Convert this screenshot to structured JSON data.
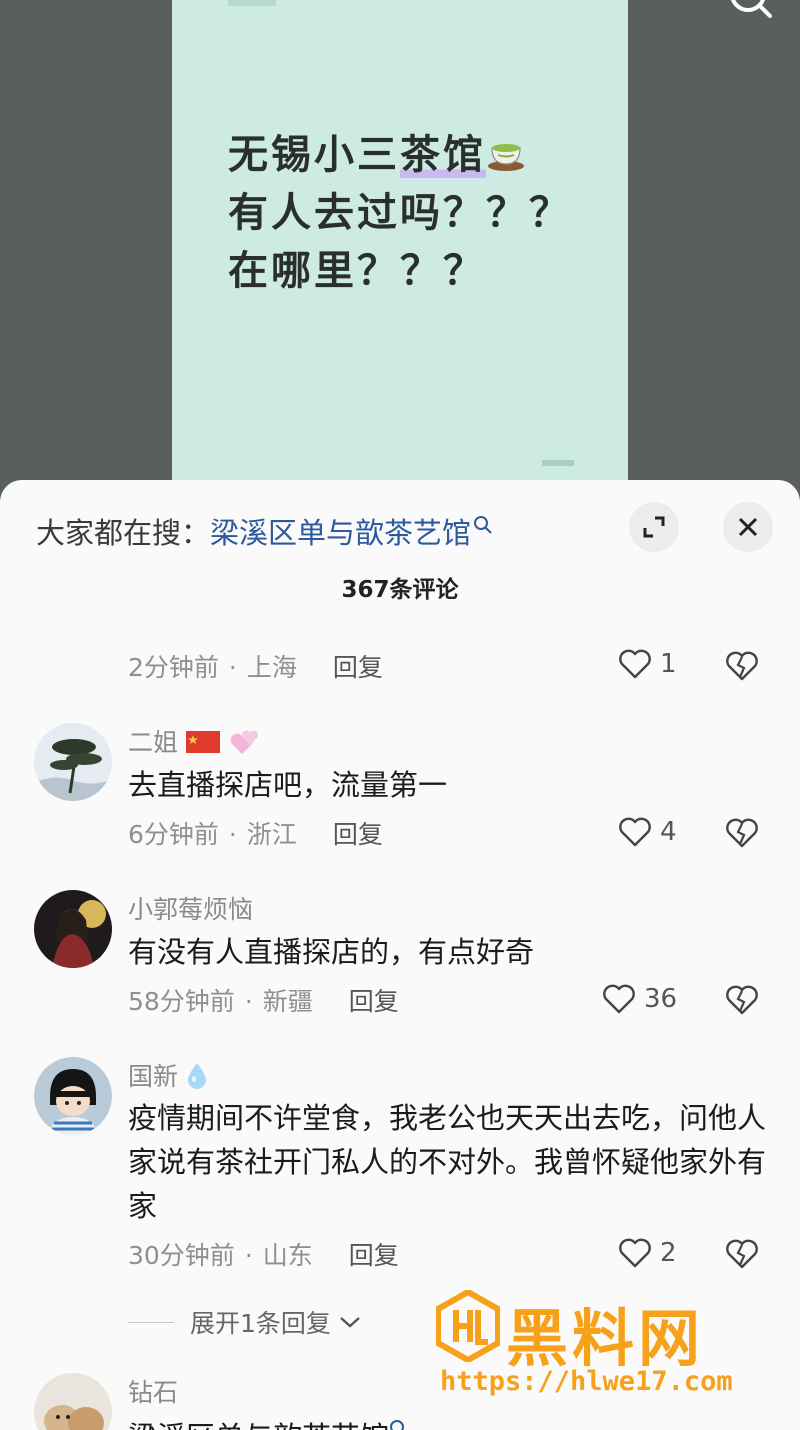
{
  "post": {
    "line1": "无锡小三",
    "line1_highlight": "茶馆",
    "line2": "有人去过吗？？？",
    "line3": "在哪里？？？"
  },
  "icons": {
    "tea": "teacup-icon",
    "search": "search-icon",
    "expand": "expand-icon",
    "close": "close-icon",
    "like": "heart-icon",
    "dislike": "broken-heart-icon",
    "chevron": "chevron-down-icon"
  },
  "colors": {
    "sheet_bg": "#fafafa",
    "link": "#2c5a9c",
    "card_bg": "#cdebe2",
    "watermark": "#f7a11a"
  },
  "sheet": {
    "hot_label": "大家都在搜：",
    "hot_term": "梁溪区单与歆茶艺馆",
    "comment_count": "367条评论"
  },
  "comments": [
    {
      "time": "2分钟前",
      "sep": "·",
      "location": "上海",
      "reply": "回复",
      "likes": "1"
    },
    {
      "user": "二姐",
      "text": "去直播探店吧，流量第一",
      "time": "6分钟前",
      "sep": "·",
      "location": "浙江",
      "reply": "回复",
      "likes": "4"
    },
    {
      "user": "小郭莓烦恼",
      "text": "有没有人直播探店的，有点好奇",
      "time": "58分钟前",
      "sep": "·",
      "location": "新疆",
      "reply": "回复",
      "likes": "36"
    },
    {
      "user": "国新",
      "text": "疫情期间不许堂食，我老公也天天出去吃，问他人家说有茶社开门私人的不对外。我曾怀疑他家外有家",
      "time": "30分钟前",
      "sep": "·",
      "location": "山东",
      "reply": "回复",
      "likes": "2"
    },
    {
      "user": "钻石",
      "text": "梁溪区单与歆茶艺馆"
    }
  ],
  "expand_replies": "展开1条回复",
  "watermark": {
    "title": "黑料网",
    "url": "https://hlwe17.com"
  }
}
